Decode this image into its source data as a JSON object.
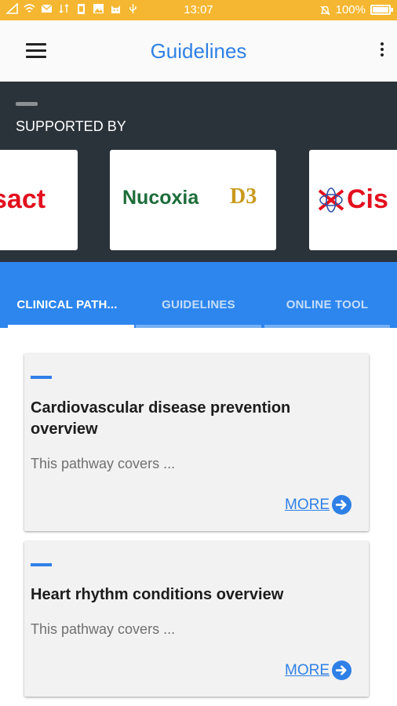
{
  "status_bar": {
    "time": "13:07",
    "battery": "100%",
    "icons": [
      "signal-icon",
      "wifi-icon",
      "mail-icon",
      "data-icon",
      "battery-saver-icon",
      "image-icon",
      "cat-icon",
      "usb-icon",
      "alarm-off-icon",
      "battery-icon"
    ]
  },
  "app_bar": {
    "title": "Guidelines",
    "menu_icon": "hamburger-menu-icon",
    "overflow_icon": "more-vert-icon"
  },
  "sponsors": {
    "heading": "SUPPORTED BY",
    "logos": [
      {
        "text": "sact",
        "color": "#e3101e"
      },
      {
        "text": "Nucoxia",
        "suffix": "D3",
        "color": "#1d6d3a",
        "suffix_color": "#c99a1c"
      },
      {
        "text": "Cis",
        "color": "#e3101e",
        "prefix_color": "#2f4fa6"
      }
    ]
  },
  "tabs": [
    {
      "label": "CLINICAL PATH...",
      "active": true
    },
    {
      "label": "GUIDELINES",
      "active": false
    },
    {
      "label": "ONLINE TOOL",
      "active": false
    }
  ],
  "cards": [
    {
      "title": "Cardiovascular disease prevention overview",
      "description": "This pathway covers ...",
      "more_label": "MORE"
    },
    {
      "title": "Heart rhythm conditions overview",
      "description": "This pathway covers ...",
      "more_label": "MORE"
    }
  ],
  "colors": {
    "status_bar": "#f5b731",
    "primary": "#2f80e6",
    "tab_bar": "#2d86ee",
    "sponsor_bg": "#2b333a"
  }
}
